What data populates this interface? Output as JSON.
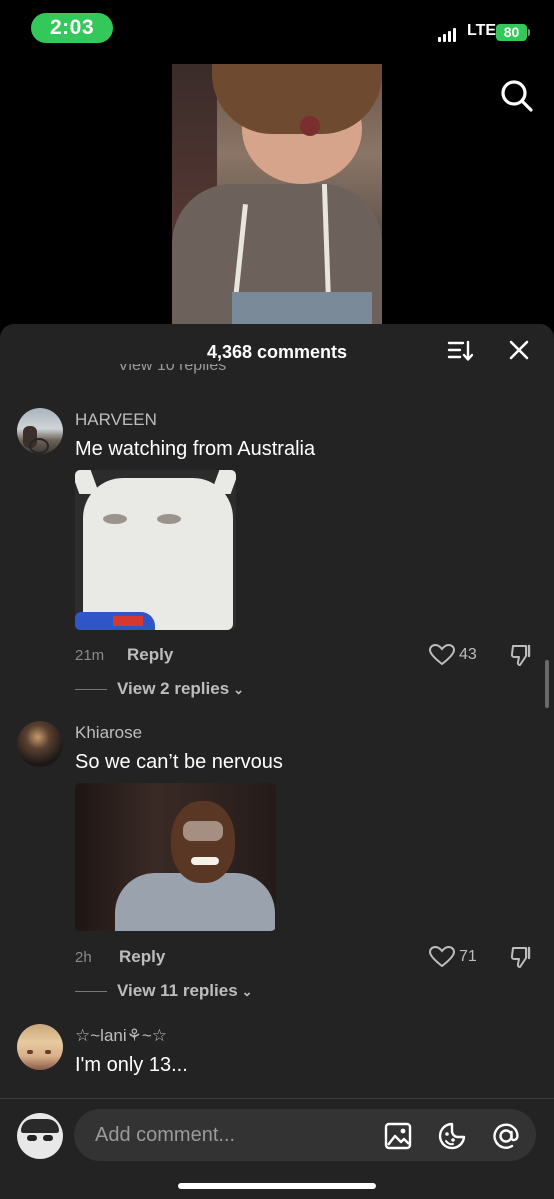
{
  "status": {
    "time": "2:03",
    "network": "LTE",
    "battery": "80"
  },
  "sheet": {
    "title": "4,368 comments",
    "partial_replies": "View 10 replies"
  },
  "comments": [
    {
      "username": "HARVEEN",
      "text": "Me watching from Australia",
      "time": "21m",
      "reply_label": "Reply",
      "likes": "43",
      "view_replies": "View 2 replies"
    },
    {
      "username": "Khiarose",
      "text": "So we can’t be nervous",
      "time": "2h",
      "reply_label": "Reply",
      "likes": "71",
      "view_replies": "View 11 replies"
    },
    {
      "username": "☆~lani⚘~☆",
      "text": "I'm only 13..."
    }
  ],
  "input": {
    "placeholder": "Add comment..."
  },
  "icons": {
    "search": "search-icon",
    "sort": "sort-icon",
    "close": "close-icon",
    "like": "heart-icon",
    "dislike": "thumbs-down-icon",
    "image": "image-icon",
    "emoji": "emoji-icon",
    "mention": "at-sign-icon"
  },
  "colors": {
    "sheet_bg": "#232323",
    "time_pill": "#34c759",
    "muted_text": "#bdbdbd"
  }
}
